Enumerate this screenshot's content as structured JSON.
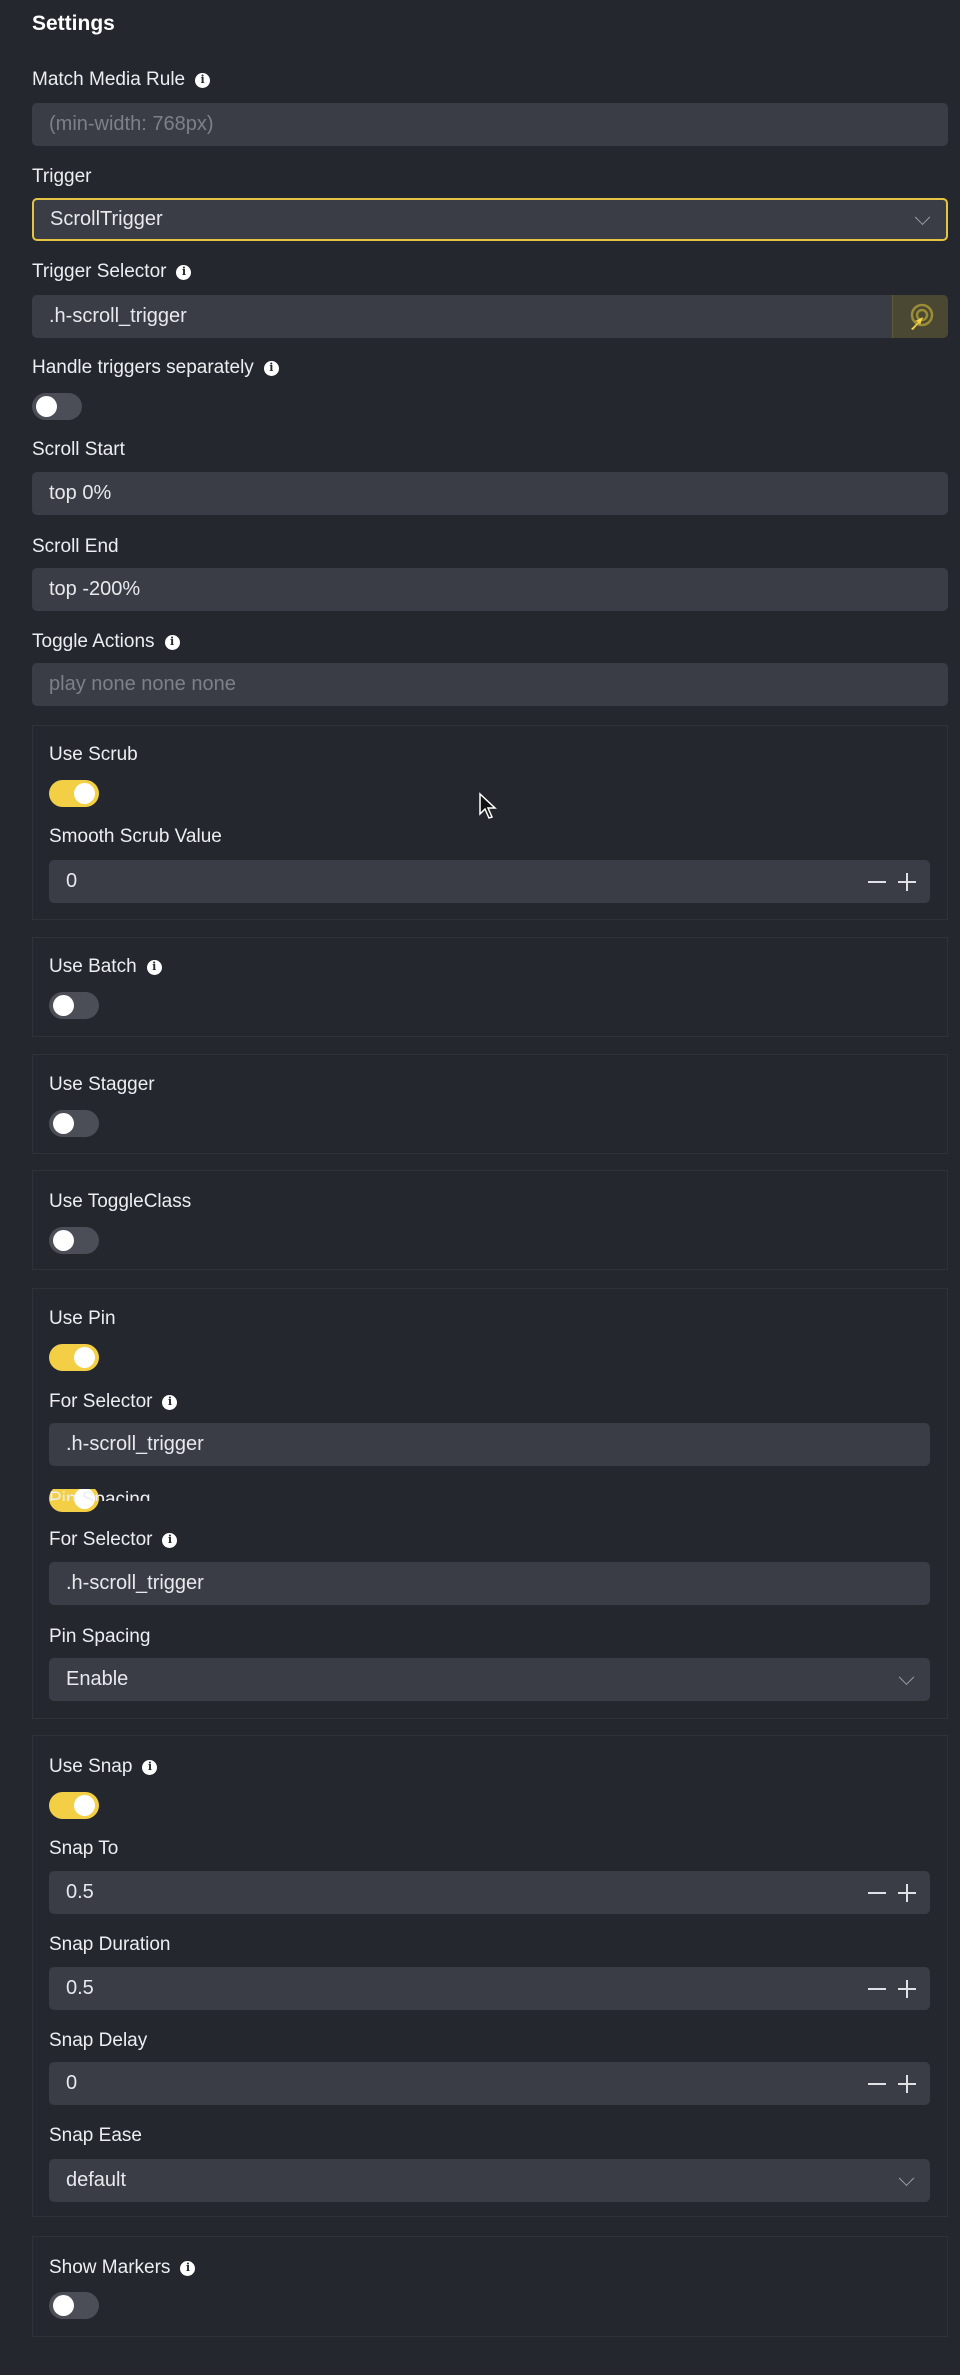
{
  "panel": {
    "title": "Settings"
  },
  "colors": {
    "background": "#24272e",
    "input": "#3a3d45",
    "accent": "#f2cf44",
    "toggle_off": "#4b4e56"
  },
  "fields": {
    "match_media": {
      "label": "Match Media Rule",
      "placeholder": "(min-width: 768px)"
    },
    "trigger": {
      "label": "Trigger",
      "value": "ScrollTrigger"
    },
    "trigger_selector": {
      "label": "Trigger Selector",
      "value": ".h-scroll_trigger",
      "icon": "target-picker-icon"
    },
    "handle_separately": {
      "label": "Handle triggers separately",
      "on": false
    },
    "scroll_start": {
      "label": "Scroll Start",
      "value": "top 0%"
    },
    "scroll_end": {
      "label": "Scroll End",
      "value": "top -200%"
    },
    "toggle_actions": {
      "label": "Toggle Actions",
      "placeholder": "play none none none"
    }
  },
  "scrub": {
    "label": "Use Scrub",
    "on": true,
    "smooth_label": "Smooth Scrub Value",
    "smooth_value": "0"
  },
  "batch": {
    "label": "Use Batch",
    "on": false
  },
  "stagger": {
    "label": "Use Stagger",
    "on": false
  },
  "toggle_class": {
    "label": "Use ToggleClass",
    "on": false
  },
  "pin": {
    "label": "Use Pin",
    "on": true,
    "for_selector_label": "For Selector",
    "for_selector_value": ".h-scroll_trigger",
    "ghost_label": "Pin Spacing",
    "for_selector_label_2": "For Selector",
    "for_selector_value_2": ".h-scroll_trigger",
    "pin_spacing_label": "Pin Spacing",
    "pin_spacing_value": "Enable"
  },
  "snap": {
    "label": "Use Snap",
    "on": true,
    "snap_to_label": "Snap To",
    "snap_to_value": "0.5",
    "duration_label": "Snap Duration",
    "duration_value": "0.5",
    "delay_label": "Snap Delay",
    "delay_value": "0",
    "ease_label": "Snap Ease",
    "ease_value": "default"
  },
  "markers": {
    "label": "Show Markers",
    "on": false
  }
}
